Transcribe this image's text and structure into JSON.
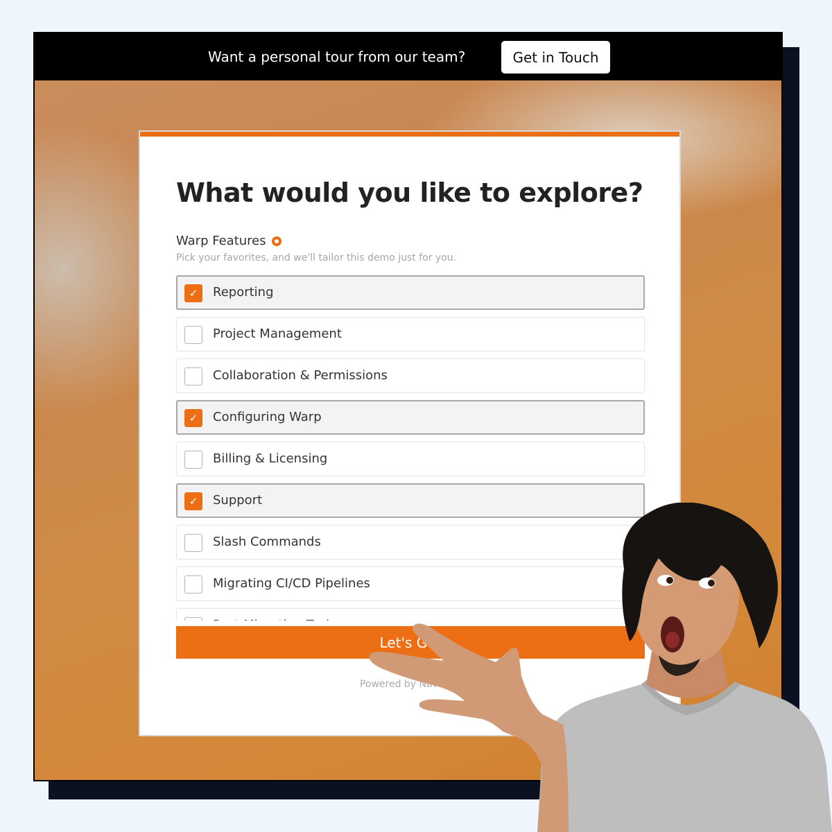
{
  "banner": {
    "text": "Want a personal tour from our team?",
    "cta_label": "Get in Touch"
  },
  "form": {
    "title": "What would you like to explore?",
    "field_label": "Warp Features",
    "field_help": "Pick your favorites, and we'll tailor this demo just for you.",
    "options": [
      {
        "label": "Reporting",
        "checked": true
      },
      {
        "label": "Project Management",
        "checked": false
      },
      {
        "label": "Collaboration & Permissions",
        "checked": false
      },
      {
        "label": "Configuring Warp",
        "checked": true
      },
      {
        "label": "Billing & Licensing",
        "checked": false
      },
      {
        "label": "Support",
        "checked": true
      },
      {
        "label": "Slash Commands",
        "checked": false
      },
      {
        "label": "Migrating CI/CD Pipelines",
        "checked": false
      },
      {
        "label": "Post-Migration Tasks",
        "checked": false
      }
    ],
    "submit_label": "Let's Go!",
    "powered_by": "Powered by Navattic"
  },
  "colors": {
    "accent": "#ec6f15",
    "banner_bg": "#000000",
    "page_bg": "#eef5fd",
    "frame_shadow": "#0b1120"
  },
  "icons": {
    "check": "checkmark-icon",
    "required": "required-indicator-icon"
  }
}
